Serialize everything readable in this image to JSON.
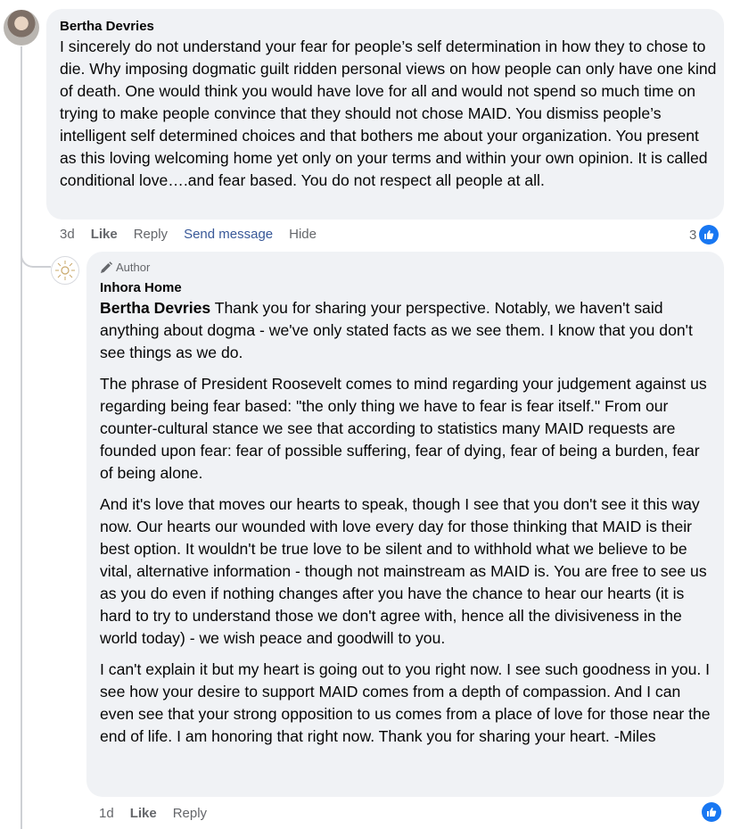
{
  "comment": {
    "author": "Bertha Devries",
    "text": "I sincerely do not understand your fear for people’s self determination in how they to chose to die. Why imposing dogmatic guilt ridden personal views on how people can only have one kind of death. One would think you would have love for all and would not spend so much time on trying to make people convince that they should not chose MAID. You dismiss people’s intelligent self determined choices and that bothers me about your organization. You present as this loving welcoming home yet only on your terms and within your own opinion. It is called conditional love….and fear based. You do not respect all people at all.",
    "time": "3d",
    "actions": {
      "like": "Like",
      "reply": "Reply",
      "send_message": "Send message",
      "hide": "Hide"
    },
    "reaction_count": "3",
    "reaction_icon": "like-icon",
    "avatar_icon": "user-photo"
  },
  "reply": {
    "badge": "Author",
    "badge_icon": "pencil-icon",
    "author": "Inhora Home",
    "mention": "Bertha Devries",
    "paragraph1_rest": " Thank you for sharing your perspective. Notably, we haven't said anything about dogma - we've only stated facts as we see them. I know that you don't see things as we do.",
    "paragraph2": "The phrase of President Roosevelt comes to mind regarding your judgement against us regarding being fear based: \"the only thing we have to fear is fear itself.\" From our counter-cultural stance we see that according to statistics many MAID requests are founded upon fear: fear of possible suffering, fear of dying, fear of being a burden, fear of being alone.",
    "paragraph3": "And it's love that moves our hearts to speak, though I see that you don't see it this way now. Our hearts our wounded with love every day for those thinking that MAID is their best option. It wouldn't be true love to be silent and to withhold what we believe to be vital, alternative information - though not mainstream as MAID is. You are free to see us as you do even if nothing changes after you have the chance to hear our hearts (it is hard to try to understand those we don't agree with, hence all the divisiveness in the world today) - we wish peace and goodwill to you.",
    "paragraph4": "I can't explain it but my heart is going out to you right now. I see such goodness in you. I see how your desire to support MAID comes from a depth of compassion. And I can even see that your strong opposition to us comes from a place of love for those near the end of life. I am honoring that right now. Thank you for sharing your heart. -Miles",
    "time": "1d",
    "actions": {
      "like": "Like",
      "reply": "Reply"
    },
    "reaction_icon": "like-icon",
    "avatar_icon": "sun-logo-icon"
  },
  "colors": {
    "bubble": "#f0f2f5",
    "link_blue": "#385898",
    "like_blue": "#1877f2",
    "muted": "#65676b"
  }
}
